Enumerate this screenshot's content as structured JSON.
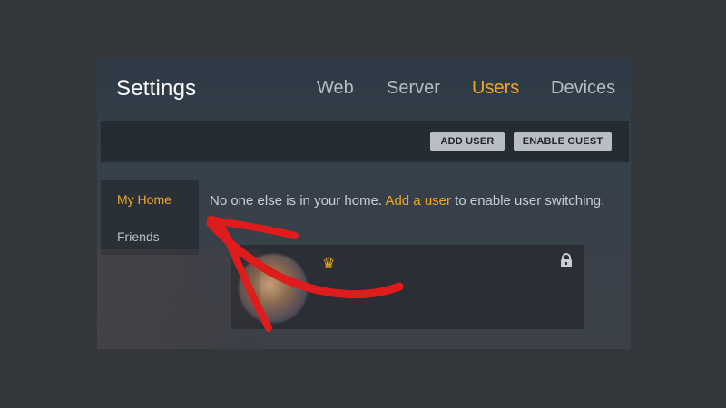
{
  "header": {
    "title": "Settings",
    "tabs": [
      {
        "label": "Web",
        "active": false
      },
      {
        "label": "Server",
        "active": false
      },
      {
        "label": "Users",
        "active": true
      },
      {
        "label": "Devices",
        "active": false
      }
    ]
  },
  "toolbar": {
    "add_user_label": "ADD USER",
    "enable_guest_label": "ENABLE GUEST"
  },
  "sidebar": {
    "items": [
      {
        "label": "My Home",
        "active": true
      },
      {
        "label": "Friends",
        "active": false
      }
    ]
  },
  "main": {
    "message_before": "No one else is in your home.",
    "message_link": "Add a user",
    "message_after": "to enable user switching."
  },
  "user_card": {
    "badge_icon": "crown-icon",
    "lock_icon": "lock-icon"
  },
  "annotation": {
    "arrow_color": "#e01b1b"
  },
  "colors": {
    "accent": "#f0a822",
    "background": "#34383d"
  }
}
